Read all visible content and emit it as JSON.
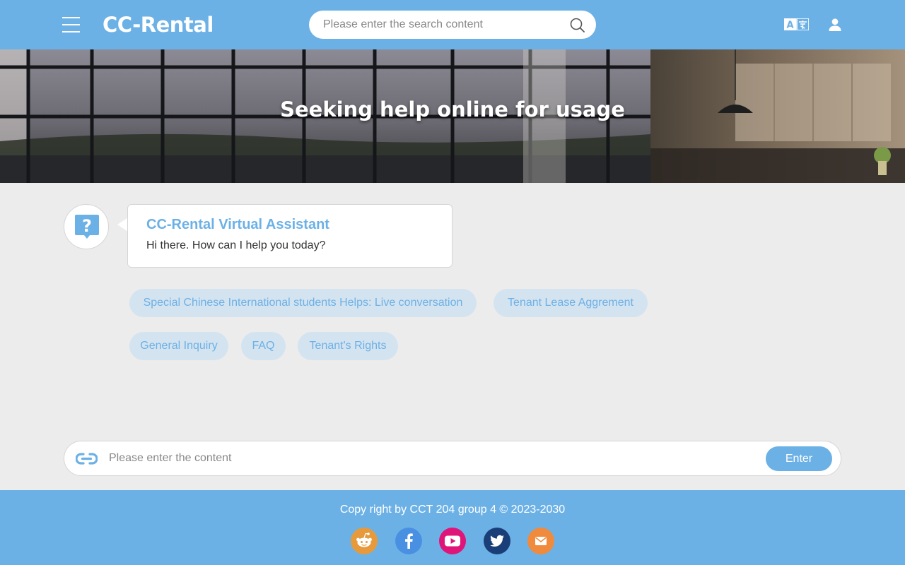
{
  "header": {
    "logo": "CC-Rental",
    "search_placeholder": "Please enter the search content",
    "icons": {
      "menu": "hamburger-menu-icon",
      "search": "search-icon",
      "language": "language-translate-icon",
      "user": "user-icon"
    }
  },
  "hero": {
    "title": "Seeking help online for usage"
  },
  "assistant": {
    "avatar_icon": "question-chat-icon",
    "name": "CC-Rental Virtual Assistant",
    "message": "Hi there. How can I help you today?"
  },
  "quick_replies": [
    "Special Chinese International students Helps: Live conversation",
    "Tenant Lease Aggrement",
    "General Inquiry",
    "FAQ",
    "Tenant's Rights"
  ],
  "chat_input": {
    "placeholder": "Please enter the content",
    "attach_icon": "link-icon",
    "enter_label": "Enter"
  },
  "footer": {
    "copyright": "Copy right by CCT 204 group 4 © 2023-2030",
    "social": [
      {
        "name": "reddit-icon",
        "color": "#e69a3c"
      },
      {
        "name": "facebook-icon",
        "color": "#4a90e2"
      },
      {
        "name": "youtube-icon",
        "color": "#e0157a"
      },
      {
        "name": "twitter-icon",
        "color": "#1a3f78"
      },
      {
        "name": "email-icon",
        "color": "#f08a3c"
      }
    ]
  },
  "colors": {
    "primary": "#6cb1e6",
    "chip_bg": "#d4e3f0",
    "page_bg": "#ececec"
  }
}
